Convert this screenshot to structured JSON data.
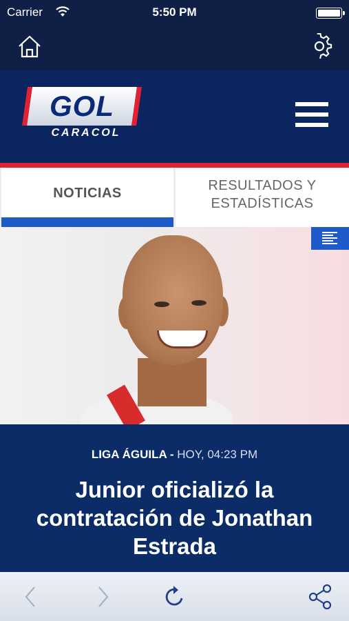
{
  "status_bar": {
    "carrier": "Carrier",
    "time": "5:50 PM"
  },
  "app_bar": {
    "home_icon": "home-icon",
    "settings_icon": "gear-icon"
  },
  "brand": {
    "logo_top": "GOL",
    "logo_bottom": "CARACOL",
    "menu_icon": "hamburger-menu-icon"
  },
  "tabs": [
    {
      "label": "NOTICIAS",
      "active": true
    },
    {
      "label_line1": "RESULTADOS Y",
      "label_line2": "ESTADÍSTICAS",
      "active": false
    }
  ],
  "article": {
    "league": "LIGA ÁGUILA -",
    "date": "HOY, 04:23 PM",
    "headline_line1": "Junior oficializó la",
    "headline_line2": "contratación de Jonathan",
    "headline_line3": "Estrada"
  },
  "toolbar": {
    "back_icon": "chevron-left-icon",
    "forward_icon": "chevron-right-icon",
    "reload_icon": "reload-icon",
    "share_icon": "share-icon"
  },
  "colors": {
    "navy": "#0b2c66",
    "accent_blue": "#1e5bc6",
    "red": "#e02233"
  }
}
